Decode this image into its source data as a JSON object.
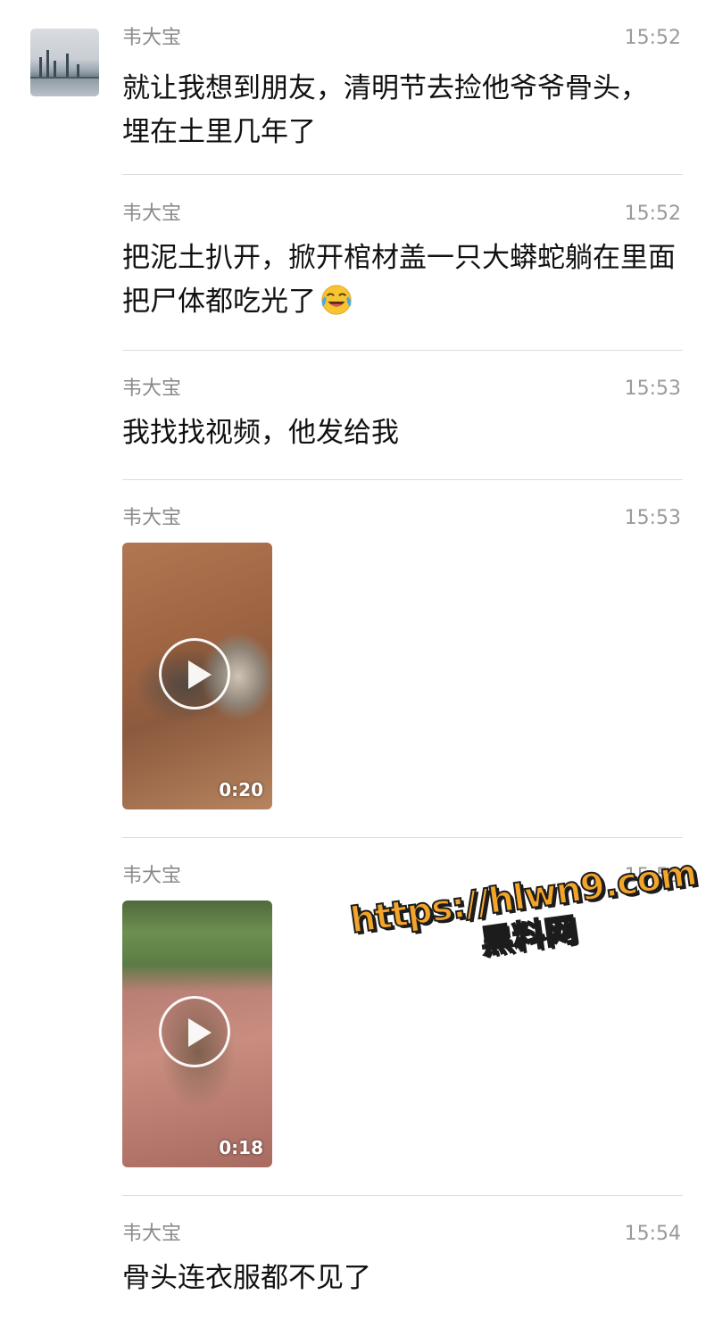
{
  "messages": [
    {
      "sender": "韦大宝",
      "time": "15:52",
      "text": "就让我想到朋友，清明节去捡他爷爷骨头，埋在土里几年了"
    },
    {
      "sender": "韦大宝",
      "time": "15:52",
      "text": "把泥土扒开，掀开棺材盖一只大蟒蛇躺在里面把尸体都吃光了",
      "emoji": "face-with-tears-of-joy-icon"
    },
    {
      "sender": "韦大宝",
      "time": "15:53",
      "text": "我找找视频，他发给我"
    },
    {
      "sender": "韦大宝",
      "time": "15:53",
      "video_duration": "0:20"
    },
    {
      "sender": "韦大宝",
      "time": "15:53",
      "video_duration": "0:18"
    },
    {
      "sender": "韦大宝",
      "time": "15:54",
      "text": "骨头连衣服都不见了"
    }
  ],
  "watermark": {
    "url": "https://hlwn9.com",
    "name": "黑料网"
  }
}
